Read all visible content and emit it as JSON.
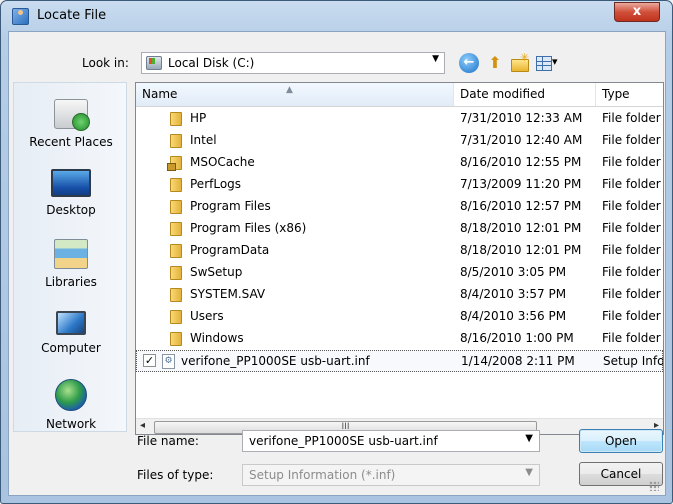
{
  "window": {
    "title": "Locate File",
    "close_glyph": "x"
  },
  "toolbar": {
    "look_in_label": "Look in:",
    "look_in_value": "Local Disk (C:)"
  },
  "places": [
    {
      "label": "Recent Places"
    },
    {
      "label": "Desktop"
    },
    {
      "label": "Libraries"
    },
    {
      "label": "Computer"
    },
    {
      "label": "Network"
    }
  ],
  "columns": {
    "name": "Name",
    "date": "Date modified",
    "type": "Type"
  },
  "files": [
    {
      "name": "HP",
      "date": "7/31/2010 12:33 AM",
      "type": "File folder"
    },
    {
      "name": "Intel",
      "date": "7/31/2010 12:40 AM",
      "type": "File folder"
    },
    {
      "name": "MSOCache",
      "date": "8/16/2010 12:55 PM",
      "type": "File folder"
    },
    {
      "name": "PerfLogs",
      "date": "7/13/2009 11:20 PM",
      "type": "File folder"
    },
    {
      "name": "Program Files",
      "date": "8/16/2010 12:57 PM",
      "type": "File folder"
    },
    {
      "name": "Program Files (x86)",
      "date": "8/18/2010 12:01 PM",
      "type": "File folder"
    },
    {
      "name": "ProgramData",
      "date": "8/18/2010 12:01 PM",
      "type": "File folder"
    },
    {
      "name": "SwSetup",
      "date": "8/5/2010 3:05 PM",
      "type": "File folder"
    },
    {
      "name": "SYSTEM.SAV",
      "date": "8/4/2010 3:57 PM",
      "type": "File folder"
    },
    {
      "name": "Users",
      "date": "8/4/2010 3:56 PM",
      "type": "File folder"
    },
    {
      "name": "Windows",
      "date": "8/16/2010 1:00 PM",
      "type": "File folder"
    },
    {
      "name": "verifone_PP1000SE usb-uart.inf",
      "date": "1/14/2008 2:11 PM",
      "type": "Setup Info"
    }
  ],
  "scrollbar": {
    "thumb_grip": "III"
  },
  "form": {
    "file_name_label": "File name:",
    "file_name_value": "verifone_PP1000SE usb-uart.inf",
    "file_type_label": "Files of type:",
    "file_type_value": "Setup Information (*.inf)"
  },
  "buttons": {
    "open": "Open",
    "cancel": "Cancel"
  }
}
